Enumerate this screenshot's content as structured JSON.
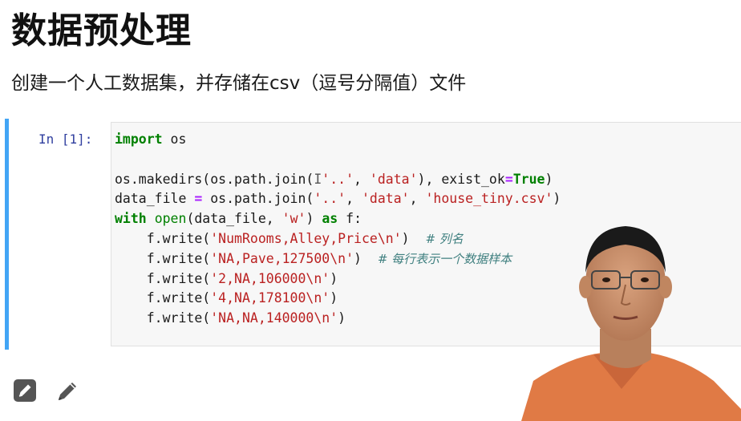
{
  "page": {
    "title": "数据预处理",
    "subtitle": "创建一个人工数据集，并存储在csv（逗号分隔值）文件"
  },
  "cell": {
    "prompt": "In [1]:",
    "code_lines": [
      [
        {
          "t": "import",
          "c": "kw"
        },
        {
          "t": " os",
          "c": ""
        }
      ],
      [],
      [
        {
          "t": "os.makedirs(os.path.join(",
          "c": ""
        },
        {
          "t": "I",
          "c": "cursor-glyph"
        },
        {
          "t": "'..'",
          "c": "str"
        },
        {
          "t": ", ",
          "c": ""
        },
        {
          "t": "'data'",
          "c": "str"
        },
        {
          "t": "), exist_ok",
          "c": ""
        },
        {
          "t": "=",
          "c": "op"
        },
        {
          "t": "True",
          "c": "kw"
        },
        {
          "t": ")",
          "c": ""
        }
      ],
      [
        {
          "t": "data_file ",
          "c": ""
        },
        {
          "t": "=",
          "c": "op"
        },
        {
          "t": " os.path.join(",
          "c": ""
        },
        {
          "t": "'..'",
          "c": "str"
        },
        {
          "t": ", ",
          "c": ""
        },
        {
          "t": "'data'",
          "c": "str"
        },
        {
          "t": ", ",
          "c": ""
        },
        {
          "t": "'house_tiny.csv'",
          "c": "str"
        },
        {
          "t": ")",
          "c": ""
        }
      ],
      [
        {
          "t": "with",
          "c": "kw"
        },
        {
          "t": " ",
          "c": ""
        },
        {
          "t": "open",
          "c": "bi"
        },
        {
          "t": "(data_file, ",
          "c": ""
        },
        {
          "t": "'w'",
          "c": "str"
        },
        {
          "t": ") ",
          "c": ""
        },
        {
          "t": "as",
          "c": "kw"
        },
        {
          "t": " f:",
          "c": ""
        }
      ],
      [
        {
          "t": "    f.write(",
          "c": ""
        },
        {
          "t": "'NumRooms,Alley,Price\\n'",
          "c": "str"
        },
        {
          "t": ")  ",
          "c": ""
        },
        {
          "t": "# 列名",
          "c": "cmt"
        }
      ],
      [
        {
          "t": "    f.write(",
          "c": ""
        },
        {
          "t": "'NA,Pave,127500\\n'",
          "c": "str"
        },
        {
          "t": ")  ",
          "c": ""
        },
        {
          "t": "# 每行表示一个数据样本",
          "c": "cmt"
        }
      ],
      [
        {
          "t": "    f.write(",
          "c": ""
        },
        {
          "t": "'2,NA,106000\\n'",
          "c": "str"
        },
        {
          "t": ")",
          "c": ""
        }
      ],
      [
        {
          "t": "    f.write(",
          "c": ""
        },
        {
          "t": "'4,NA,178100\\n'",
          "c": "str"
        },
        {
          "t": ")",
          "c": ""
        }
      ],
      [
        {
          "t": "    f.write(",
          "c": ""
        },
        {
          "t": "'NA,NA,140000\\n'",
          "c": "str"
        },
        {
          "t": ")",
          "c": ""
        }
      ]
    ]
  },
  "toolbar": {
    "icons": [
      "edit-box-icon",
      "pencil-icon"
    ]
  },
  "colors": {
    "cell_border": "#42a5f5",
    "keyword": "#008000",
    "string": "#ba2121",
    "operator": "#aa22ff",
    "comment": "#408080",
    "prompt": "#303f9f"
  }
}
